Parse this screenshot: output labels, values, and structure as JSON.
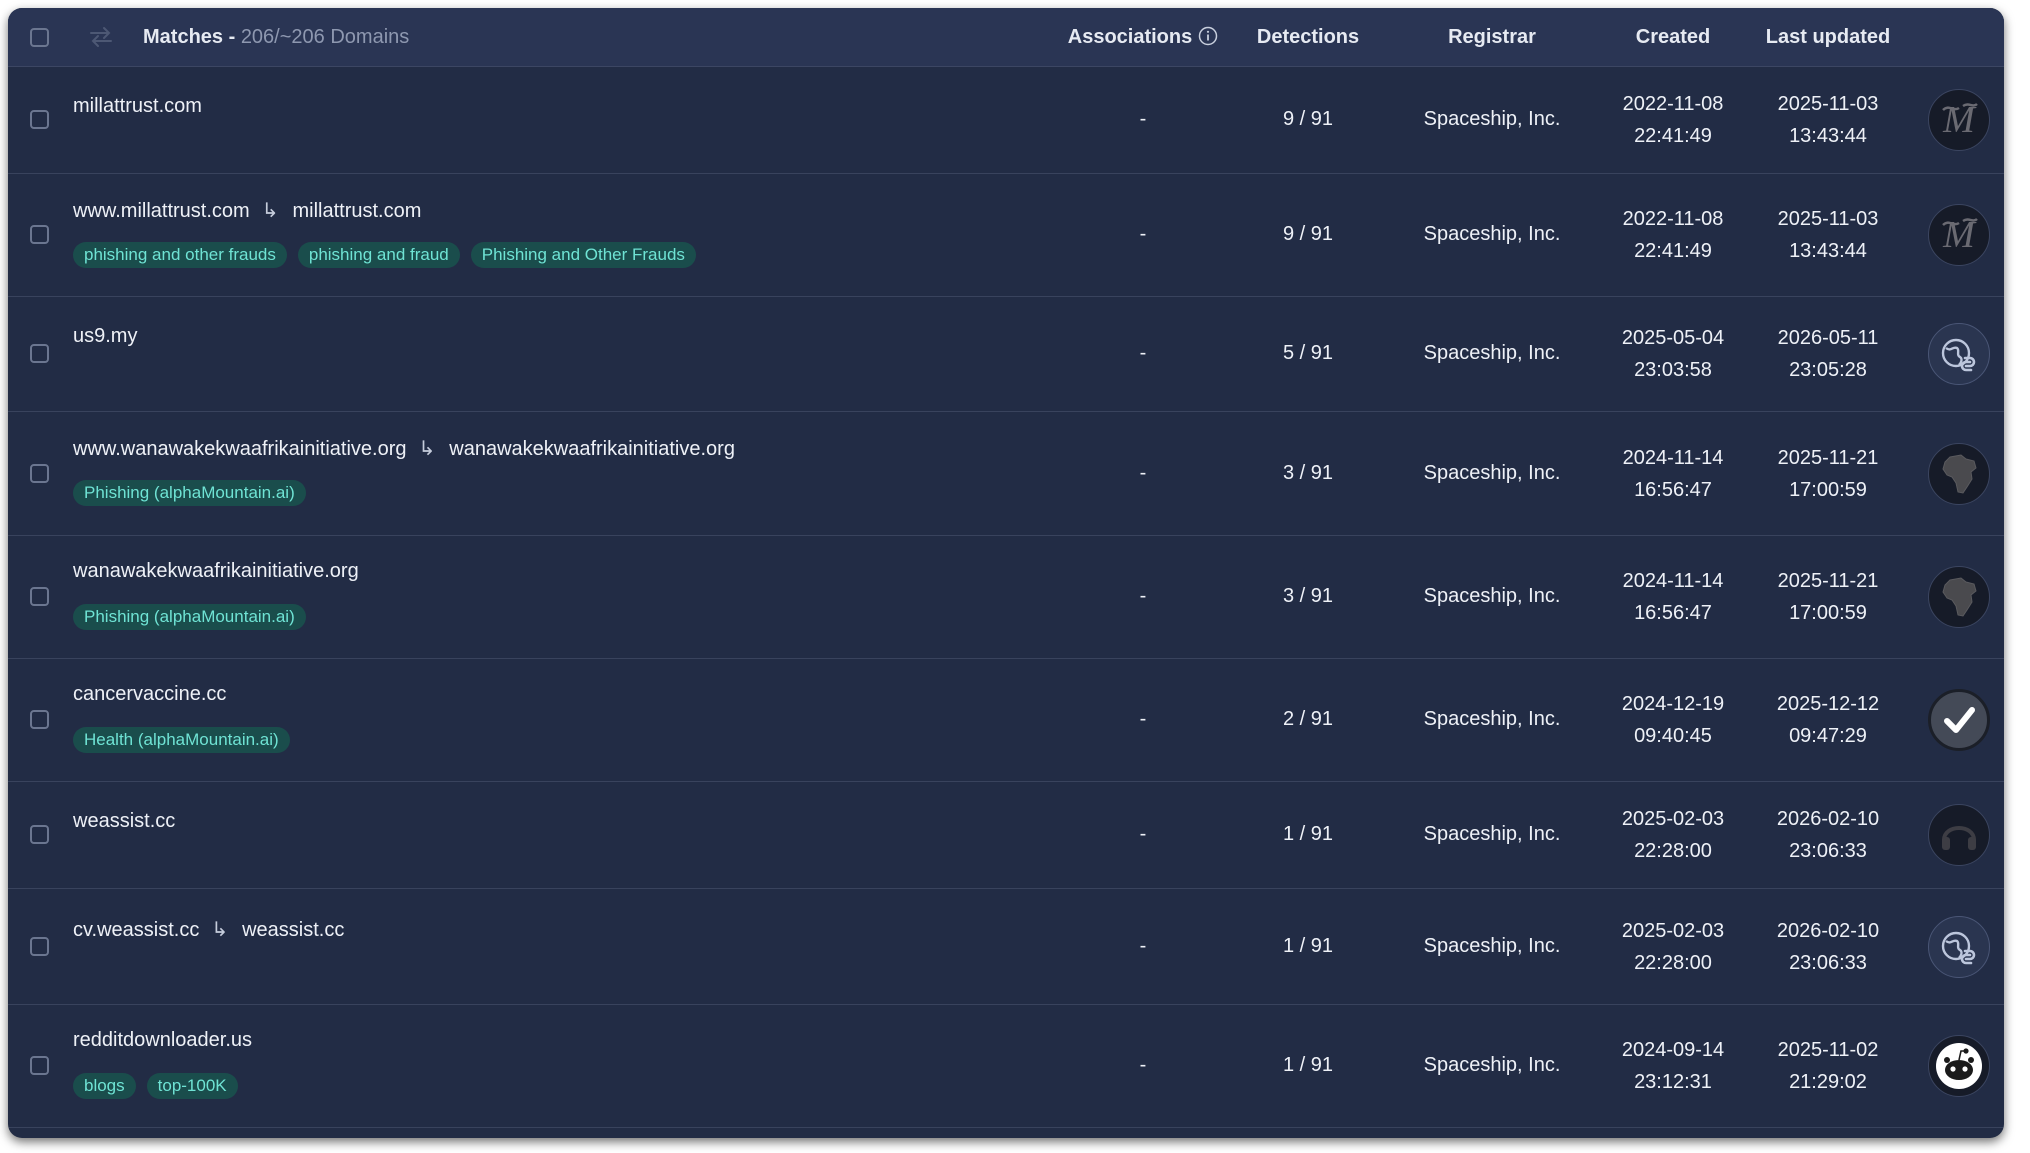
{
  "header": {
    "title": "Matches - ",
    "count": "206/~206 Domains",
    "columns": {
      "associations": "Associations",
      "detections": "Detections",
      "registrar": "Registrar",
      "created": "Created",
      "last_updated": "Last updated"
    }
  },
  "rows": [
    {
      "domain": "millattrust.com",
      "redirect": "",
      "tags": [],
      "associations": "-",
      "detections": "9 / 91",
      "registrar": "Spaceship, Inc.",
      "created_date": "2022-11-08",
      "created_time": "22:41:49",
      "updated_date": "2025-11-03",
      "updated_time": "13:43:44",
      "icon": "monogram-m-favicon"
    },
    {
      "domain": "www.millattrust.com",
      "redirect": "millattrust.com",
      "tags": [
        "phishing and other frauds",
        "phishing and fraud",
        "Phishing and Other Frauds"
      ],
      "associations": "-",
      "detections": "9 / 91",
      "registrar": "Spaceship, Inc.",
      "created_date": "2022-11-08",
      "created_time": "22:41:49",
      "updated_date": "2025-11-03",
      "updated_time": "13:43:44",
      "icon": "monogram-m-favicon"
    },
    {
      "domain": "us9.my",
      "redirect": "",
      "tags": [],
      "associations": "-",
      "detections": "5 / 91",
      "registrar": "Spaceship, Inc.",
      "created_date": "2025-05-04",
      "created_time": "23:03:58",
      "updated_date": "2026-05-11",
      "updated_time": "23:05:28",
      "icon": "globe-link-icon"
    },
    {
      "domain": "www.wanawakekwaafrikainitiative.org",
      "redirect": "wanawakekwaafrikainitiative.org",
      "tags": [
        "Phishing (alphaMountain.ai)"
      ],
      "associations": "-",
      "detections": "3 / 91",
      "registrar": "Spaceship, Inc.",
      "created_date": "2024-11-14",
      "created_time": "16:56:47",
      "updated_date": "2025-11-21",
      "updated_time": "17:00:59",
      "icon": "africa-map-favicon"
    },
    {
      "domain": "wanawakekwaafrikainitiative.org",
      "redirect": "",
      "tags": [
        "Phishing (alphaMountain.ai)"
      ],
      "associations": "-",
      "detections": "3 / 91",
      "registrar": "Spaceship, Inc.",
      "created_date": "2024-11-14",
      "created_time": "16:56:47",
      "updated_date": "2025-11-21",
      "updated_time": "17:00:59",
      "icon": "africa-map-favicon"
    },
    {
      "domain": "cancervaccine.cc",
      "redirect": "",
      "tags": [
        "Health (alphaMountain.ai)"
      ],
      "associations": "-",
      "detections": "2 / 91",
      "registrar": "Spaceship, Inc.",
      "created_date": "2024-12-19",
      "created_time": "09:40:45",
      "updated_date": "2025-12-12",
      "updated_time": "09:47:29",
      "icon": "checkmark-favicon"
    },
    {
      "domain": "weassist.cc",
      "redirect": "",
      "tags": [],
      "associations": "-",
      "detections": "1 / 91",
      "registrar": "Spaceship, Inc.",
      "created_date": "2025-02-03",
      "created_time": "22:28:00",
      "updated_date": "2026-02-10",
      "updated_time": "23:06:33",
      "icon": "headset-favicon"
    },
    {
      "domain": "cv.weassist.cc",
      "redirect": "weassist.cc",
      "tags": [],
      "associations": "-",
      "detections": "1 / 91",
      "registrar": "Spaceship, Inc.",
      "created_date": "2025-02-03",
      "created_time": "22:28:00",
      "updated_date": "2026-02-10",
      "updated_time": "23:06:33",
      "icon": "globe-link-icon"
    },
    {
      "domain": "redditdownloader.us",
      "redirect": "",
      "tags": [
        "blogs",
        "top-100K"
      ],
      "associations": "-",
      "detections": "1 / 91",
      "registrar": "Spaceship, Inc.",
      "created_date": "2024-09-14",
      "created_time": "23:12:31",
      "updated_date": "2025-11-02",
      "updated_time": "21:29:02",
      "icon": "reddit-alien-favicon"
    }
  ]
}
